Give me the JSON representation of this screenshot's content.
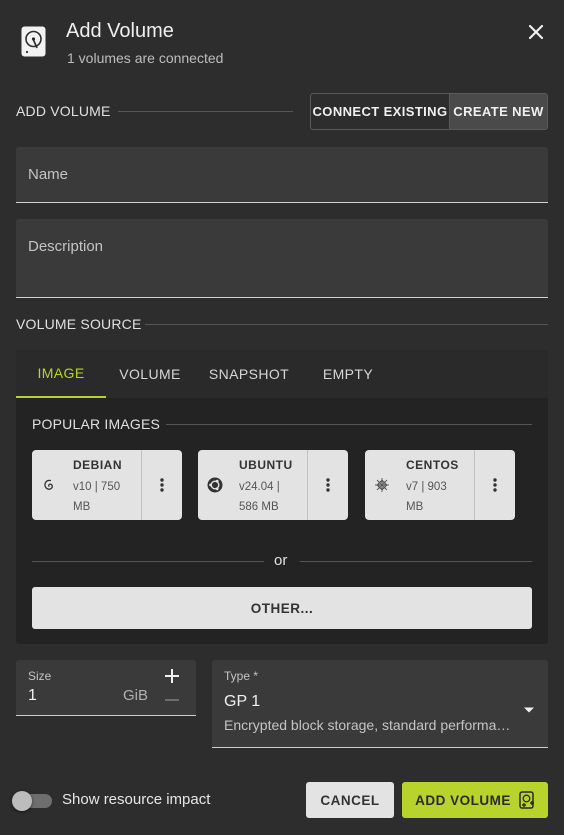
{
  "dialog": {
    "title": "Add Volume",
    "subtitle": "1 volumes are connected",
    "icon": "hard-disk-icon",
    "close_icon": "close-icon"
  },
  "add_volume_section": {
    "label": "ADD VOLUME",
    "modes": [
      {
        "label": "CONNECT EXISTING",
        "selected": false
      },
      {
        "label": "CREATE NEW",
        "selected": true
      }
    ]
  },
  "form": {
    "name_placeholder": "Name",
    "description_placeholder": "Description"
  },
  "volume_source": {
    "label": "VOLUME SOURCE",
    "tabs": [
      {
        "label": "IMAGE",
        "active": true
      },
      {
        "label": "VOLUME",
        "active": false
      },
      {
        "label": "SNAPSHOT",
        "active": false
      },
      {
        "label": "EMPTY",
        "active": false
      }
    ],
    "popular_images_label": "POPULAR IMAGES",
    "images": [
      {
        "name": "DEBIAN",
        "meta_line1": "v10 | 750",
        "meta_line2": "MB",
        "icon": "debian-swirl-icon"
      },
      {
        "name": "UBUNTU",
        "meta_line1": "v24.04 |",
        "meta_line2": "586 MB",
        "icon": "ubuntu-circle-icon"
      },
      {
        "name": "CENTOS",
        "meta_line1": "v7 | 903",
        "meta_line2": "MB",
        "icon": "centos-flower-icon"
      }
    ],
    "or_text": "or",
    "other_button": "OTHER..."
  },
  "size": {
    "label": "Size",
    "value": "1",
    "unit": "GiB",
    "increment_icon": "plus-icon",
    "decrement_icon": "minus-icon"
  },
  "type": {
    "label": "Type *",
    "value": "GP 1",
    "description": "Encrypted block storage, standard performa…",
    "dropdown_icon": "caret-down-icon"
  },
  "footer": {
    "toggle_label": "Show resource impact",
    "toggle_on": false,
    "cancel_label": "CANCEL",
    "add_label": "ADD VOLUME",
    "add_icon": "add-disk-icon"
  },
  "colors": {
    "background": "#2d2d2d",
    "accent": "#b8d32b",
    "card": "#e3e3e3"
  }
}
